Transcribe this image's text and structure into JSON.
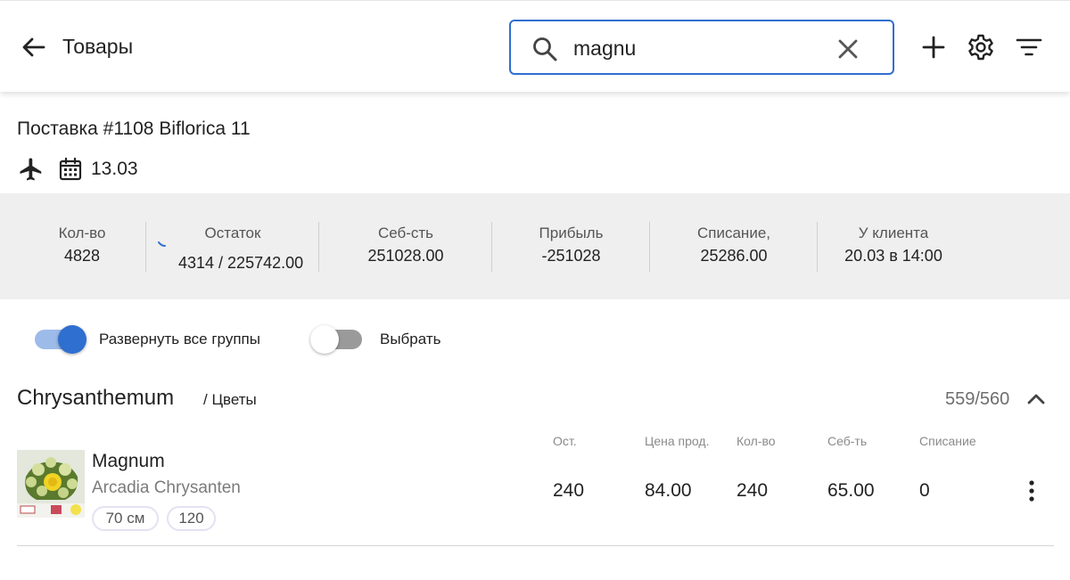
{
  "header": {
    "title": "Товары",
    "search_value": "magnu",
    "icons": [
      "arrow-back-icon",
      "search-icon",
      "close-icon",
      "add-icon",
      "gear-icon",
      "filter-icon"
    ]
  },
  "delivery": {
    "title": "Поставка #1108 Biflorica 11",
    "date": "13.03",
    "icons": [
      "plane-icon",
      "calendar-icon"
    ]
  },
  "stats": [
    {
      "label": "Кол-во",
      "value": "4828"
    },
    {
      "label": "Остаток",
      "value": "4314 / 225742.00"
    },
    {
      "label": "Себ-сть",
      "value": "251028.00"
    },
    {
      "label": "Прибыль",
      "value": "-251028"
    },
    {
      "label": "Списание,",
      "value": "25286.00"
    },
    {
      "label": "У клиента",
      "value": "20.03 в 14:00"
    }
  ],
  "toggles": {
    "expand_all": {
      "label": "Развернуть все группы",
      "on": true
    },
    "select": {
      "label": "Выбрать",
      "on": false
    }
  },
  "group": {
    "name": "Chrysanthemum",
    "category": "/ Цветы",
    "count": "559/560",
    "expanded": true
  },
  "product": {
    "name": "Magnum",
    "grower": "Arcadia Chrysanten",
    "chips": [
      "70 см",
      "120"
    ],
    "columns": [
      {
        "header": "Ост.",
        "value": "240"
      },
      {
        "header": "Цена прод.",
        "value": "84.00"
      },
      {
        "header": "Кол-во",
        "value": "240"
      },
      {
        "header": "Себ-ть",
        "value": "65.00"
      },
      {
        "header": "Списание",
        "value": "0"
      }
    ]
  },
  "colors": {
    "accent": "#2f6fd0",
    "toggle_on_track": "#9dbbe8",
    "toggle_on_knob": "#2f6fd0",
    "toggle_off_track": "#9a9a9a",
    "toggle_off_knob": "#ffffff",
    "stats_bg": "#efefef",
    "chip_border": "#e5e1f3"
  }
}
